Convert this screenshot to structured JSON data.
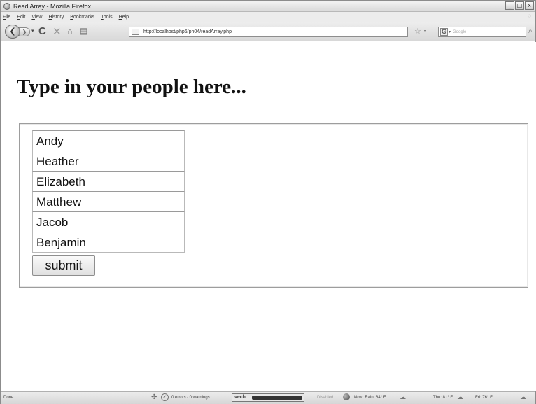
{
  "window": {
    "title": "Read Array - Mozilla Firefox",
    "controls": {
      "minimize": "_",
      "maximize": "□",
      "close": "x"
    }
  },
  "menubar": {
    "items": [
      {
        "label": "File",
        "accel": "F",
        "rest": "ile"
      },
      {
        "label": "Edit",
        "accel": "E",
        "rest": "dit"
      },
      {
        "label": "View",
        "accel": "V",
        "rest": "iew"
      },
      {
        "label": "History",
        "accel": "H",
        "rest": "istory"
      },
      {
        "label": "Bookmarks",
        "accel": "B",
        "rest": "ookmarks"
      },
      {
        "label": "Tools",
        "accel": "T",
        "rest": "ools"
      },
      {
        "label": "Help",
        "accel": "H",
        "rest": "elp"
      }
    ]
  },
  "navbar": {
    "url": "http://localhost/php6/ph04/readArray.php",
    "search_placeholder": "Google",
    "search_engine_glyph": "G"
  },
  "page": {
    "heading": "Type in your people here...",
    "people": [
      "Andy",
      "Heather",
      "Elizabeth",
      "Matthew",
      "Jacob",
      "Benjamin"
    ],
    "submit_label": "submit"
  },
  "statusbar": {
    "status": "Done",
    "errors": "0 errors / 0 warnings",
    "vech_label": "vech",
    "disabled": "Disabled",
    "weather_now": "Now: Rain, 64° F",
    "weather_thu": "Thu: 81° F",
    "weather_fri": "Fri: 76° F"
  }
}
